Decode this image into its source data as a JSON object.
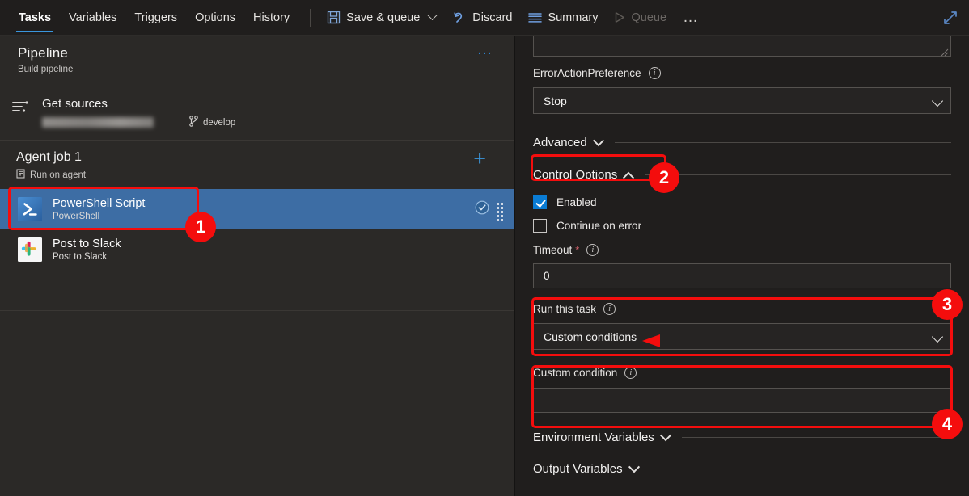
{
  "toolbar": {
    "tabs": [
      {
        "label": "Tasks",
        "active": true
      },
      {
        "label": "Variables",
        "active": false
      },
      {
        "label": "Triggers",
        "active": false
      },
      {
        "label": "Options",
        "active": false
      },
      {
        "label": "History",
        "active": false
      }
    ],
    "save_queue_label": "Save & queue",
    "discard_label": "Discard",
    "summary_label": "Summary",
    "queue_label": "Queue",
    "more_label": "…",
    "expand_icon": "expand-diagonal-icon"
  },
  "left_panel": {
    "pipeline": {
      "title": "Pipeline",
      "subtitle": "Build pipeline",
      "more_label": "…"
    },
    "get_sources": {
      "title": "Get sources",
      "repo_redacted": "",
      "branch": "develop"
    },
    "agent_job": {
      "title": "Agent job 1",
      "subtitle": "Run on agent",
      "add_label": "+"
    },
    "tasks": [
      {
        "name": "PowerShell Script",
        "sub": "PowerShell",
        "icon": "powershell-icon",
        "selected": true,
        "status_icon": "check-circle-icon"
      },
      {
        "name": "Post to Slack",
        "sub": "Post to Slack",
        "icon": "slack-icon",
        "selected": false,
        "status_icon": ""
      }
    ]
  },
  "right_panel": {
    "script_textarea_value": "",
    "error_action_preference": {
      "label": "ErrorActionPreference",
      "value": "Stop"
    },
    "advanced_section": "Advanced",
    "control_options_section": "Control Options",
    "enabled": {
      "label": "Enabled",
      "checked": true
    },
    "continue_on_error": {
      "label": "Continue on error",
      "checked": false
    },
    "timeout": {
      "label": "Timeout",
      "required": "*",
      "value": "0"
    },
    "run_this_task": {
      "label": "Run this task",
      "value": "Custom conditions"
    },
    "custom_condition": {
      "label": "Custom condition",
      "value": "",
      "placeholder": ""
    },
    "environment_variables_section": "Environment Variables",
    "output_variables_section": "Output Variables"
  },
  "annotations": [
    {
      "number": "1",
      "target": "powershell-task-row"
    },
    {
      "number": "2",
      "target": "control-options-section"
    },
    {
      "number": "3",
      "target": "run-this-task-field"
    },
    {
      "number": "4",
      "target": "custom-condition-field"
    }
  ],
  "colors": {
    "annotation_red": "#f40d0d",
    "accent_blue": "#0a7cd4",
    "selected_row": "#3d6da4",
    "left_bg": "#2b2927",
    "right_bg": "#201e1d"
  }
}
